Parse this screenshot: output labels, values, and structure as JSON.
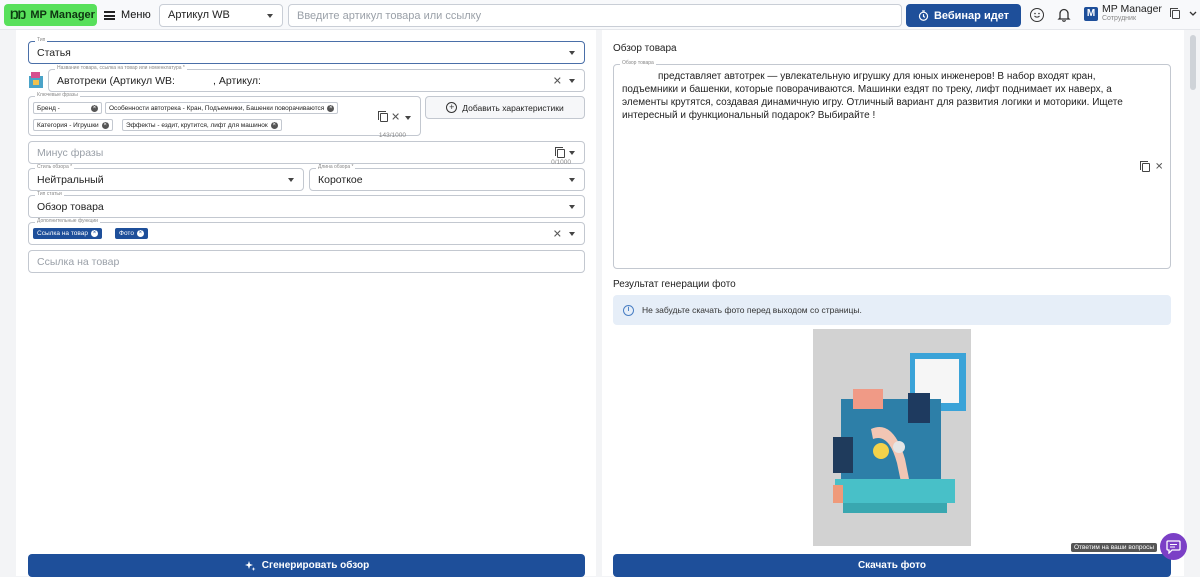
{
  "topbar": {
    "logo_text": "MP Manager",
    "menu_label": "Меню",
    "wb_select": "Артикул WB",
    "search_placeholder": "Введите артикул товара или ссылку",
    "webinar_label": "Вебинар идет",
    "user_initial": "M",
    "user_name": "MP Manager",
    "user_role": "Сотрудник"
  },
  "left": {
    "type": {
      "label": "Тип",
      "value": "Статья"
    },
    "product": {
      "label": "Название товара, ссылка на товар или номенклатура *",
      "value": "Автотреки (Артикул WB:",
      "value2": ", Артикул:"
    },
    "keywords": {
      "label": "Ключевые фразы",
      "chips": [
        "Бренд -",
        "Особенности автотрека - Кран, Подъемники, Башенки поворачиваются",
        "Категория - Игрушки",
        "Эффекты - ездит, крутится, лифт для машинок"
      ],
      "counter": "143/1000"
    },
    "add_char_button": "Добавить характеристики",
    "minus": {
      "placeholder": "Минус фразы",
      "counter": "0/1000"
    },
    "style": {
      "label": "Стиль обзора *",
      "value": "Нейтральный"
    },
    "length": {
      "label": "Длина обзора *",
      "value": "Короткое"
    },
    "article_type": {
      "label": "Тип статьи",
      "value": "Обзор товара"
    },
    "extra": {
      "label": "Дополнительные функции",
      "chips": [
        "Ссылка на товар",
        "Фото"
      ]
    },
    "link_placeholder": "Ссылка на товар",
    "generate_button": "Сгенерировать обзор"
  },
  "right": {
    "review_title": "Обзор товара",
    "review_label": "Обзор товара",
    "review_text": "представляет автотрек — увлекательную игрушку для юных инженеров! В набор входят кран, подъемники и башенки, которые поворачиваются. Машинки ездят по треку, лифт поднимает их наверх, а элементы крутятся, создавая динамичную игру. Отличный вариант для развития логики и моторики. Ищете интересный и функциональный подарок? Выбирайте !",
    "photo_result_title": "Результат генерации фото",
    "info_text": "Не забудьте скачать фото перед выходом со страницы.",
    "download_button": "Скачать фото"
  },
  "chat": {
    "tooltip": "Ответим на ваши вопросы"
  },
  "colors": {
    "brand_green": "#58e05b",
    "primary_blue": "#1e4f9a",
    "info_bg": "#e6eef8"
  }
}
